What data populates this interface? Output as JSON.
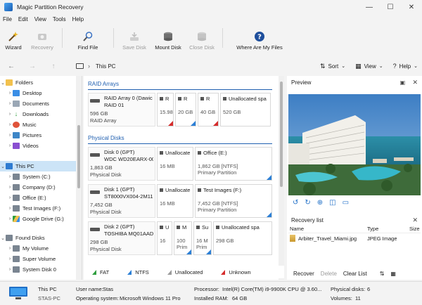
{
  "window": {
    "title": "Magic Partition Recovery",
    "minimize": "—",
    "maximize": "☐",
    "close": "✕"
  },
  "menu": [
    "File",
    "Edit",
    "View",
    "Tools",
    "Help"
  ],
  "toolbar": {
    "wizard": "Wizard",
    "recovery": "Recovery",
    "find_file": "Find File",
    "save_disk": "Save Disk",
    "mount_disk": "Mount Disk",
    "close_disk": "Close Disk",
    "where_are_my_files": "Where Are My Files"
  },
  "nav": {
    "back": "←",
    "forward": "→",
    "up": "↑",
    "address": "This PC",
    "sort": "Sort",
    "view": "View",
    "help": "Help"
  },
  "tree": {
    "folders": "Folders",
    "folder_items": [
      "Desktop",
      "Documents",
      "Downloads",
      "Music",
      "Pictures",
      "Videos"
    ],
    "this_pc": "This PC",
    "drives": [
      "System (C:)",
      "Company (D:)",
      "Office (E:)",
      "Test Images (F:)",
      "Google Drive (G:)"
    ],
    "found_disks": "Found Disks",
    "found_items": [
      "My Volume",
      "Super Volume",
      "System Disk 0"
    ]
  },
  "center": {
    "raid_section": "RAID Arrays",
    "physical_section": "Physical Disks",
    "raid": {
      "name1": "RAID Array 0 (Dawic",
      "name2": "RAID 01",
      "size": "596 GB",
      "type": "RAID Array",
      "parts": [
        {
          "label": "R",
          "size": "15.98",
          "color": "#d62b2b"
        },
        {
          "label": "R",
          "size": "20 GB",
          "color": "#2b7fd6"
        },
        {
          "label": "R",
          "size": "40 GB",
          "color": "#d62b2b"
        },
        {
          "label": "Unallocated spa",
          "size": "520 GB",
          "color": ""
        }
      ]
    },
    "disks": [
      {
        "name1": "Disk 0 (GPT)",
        "name2": "WDC WD20EARX-00",
        "size": "1,863 GB",
        "type": "Physical Disk",
        "parts": [
          {
            "label": "Unallocate",
            "size": "16 MB",
            "fs": "",
            "kind": "",
            "color": ""
          },
          {
            "label": "Office (E:)",
            "size": "1,862 GB [NTFS]",
            "fs": "",
            "kind": "Primary Partition",
            "color": "#2b7fd6"
          }
        ]
      },
      {
        "name1": "Disk 1 (GPT)",
        "name2": "ST8000VX004-2M11",
        "size": "7,452 GB",
        "type": "Physical Disk",
        "parts": [
          {
            "label": "Unallocate",
            "size": "16 MB",
            "fs": "",
            "kind": "",
            "color": ""
          },
          {
            "label": "Test Images (F:)",
            "size": "7,452 GB [NTFS]",
            "fs": "",
            "kind": "Primary Partition",
            "color": "#2b7fd6"
          }
        ]
      },
      {
        "name1": "Disk 2 (GPT)",
        "name2": "TOSHIBA MQ01AAD",
        "size": "298 GB",
        "type": "Physical Disk",
        "parts": [
          {
            "label": "U",
            "size": "16",
            "kind": "",
            "color": ""
          },
          {
            "label": "M",
            "size": "100",
            "kind": "Prim",
            "color": "#2b7fd6"
          },
          {
            "label": "Su",
            "size": "16 M",
            "kind": "Prim",
            "color": "#2b7fd6"
          },
          {
            "label": "Unallocated spa",
            "size": "298 GB",
            "kind": "",
            "color": ""
          }
        ]
      }
    ],
    "legend": [
      {
        "label": "FAT",
        "color": "#2e9e3e"
      },
      {
        "label": "NTFS",
        "color": "#2b7fd6"
      },
      {
        "label": "Unallocated",
        "color": "#9a9a9a"
      },
      {
        "label": "Unknown",
        "color": "#d62b2b"
      }
    ]
  },
  "preview": {
    "title": "Preview",
    "close": "✕"
  },
  "recovery_list": {
    "title": "Recovery list",
    "close": "✕",
    "col_name": "Name",
    "col_type": "Type",
    "col_size": "Size",
    "items": [
      {
        "name": "Arbiter_Travel_Miami.jpg",
        "type": "JPEG Image"
      }
    ],
    "recover": "Recover",
    "delete": "Delete",
    "clear": "Clear List"
  },
  "status": {
    "pc_name": "This PC",
    "pc_host": "STAS-PC",
    "user_label": "User name:",
    "user_value": "Stas",
    "os_label": "Operating system:",
    "os_value": "Microsoft Windows 11 Pro",
    "proc_label": "Processor:",
    "proc_value": "Intel(R) Core(TM) i9-9900K CPU @ 3.60...",
    "ram_label": "Installed RAM:",
    "ram_value": "64 GB",
    "disks_label": "Physical disks:",
    "disks_value": "6",
    "vol_label": "Volumes:",
    "vol_value": "11"
  }
}
